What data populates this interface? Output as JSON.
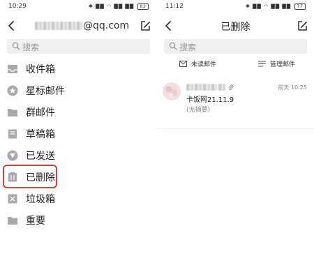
{
  "left": {
    "status": {
      "time": "10:29",
      "icons": "✱ ▇▇ ◠ ▇▇ ▇▇",
      "battery": "82"
    },
    "header": {
      "account_suffix": "@qq.com"
    },
    "search": {
      "placeholder": "搜索"
    },
    "folders": [
      {
        "label": "收件箱",
        "icon": "inbox-icon"
      },
      {
        "label": "星标邮件",
        "icon": "star-icon"
      },
      {
        "label": "群邮件",
        "icon": "folder-icon"
      },
      {
        "label": "草稿箱",
        "icon": "draft-icon"
      },
      {
        "label": "已发送",
        "icon": "send-icon"
      },
      {
        "label": "已删除",
        "icon": "trash-icon"
      },
      {
        "label": "垃圾箱",
        "icon": "spam-icon"
      },
      {
        "label": "重要",
        "icon": "folder-icon"
      }
    ],
    "highlight_color": "#e53935"
  },
  "right": {
    "status": {
      "time": "11:12",
      "icons": "✱ ▇▇ ◠ ▇▇ ▇▇",
      "battery": "77"
    },
    "header": {
      "title": "已删除"
    },
    "search": {
      "placeholder": "搜索"
    },
    "actions": {
      "unread": "未读邮件",
      "manage": "管理邮件"
    },
    "mail": {
      "time": "前天 10:25",
      "subject": "卡饭网21.11.9",
      "summary": "(无摘要)"
    }
  }
}
